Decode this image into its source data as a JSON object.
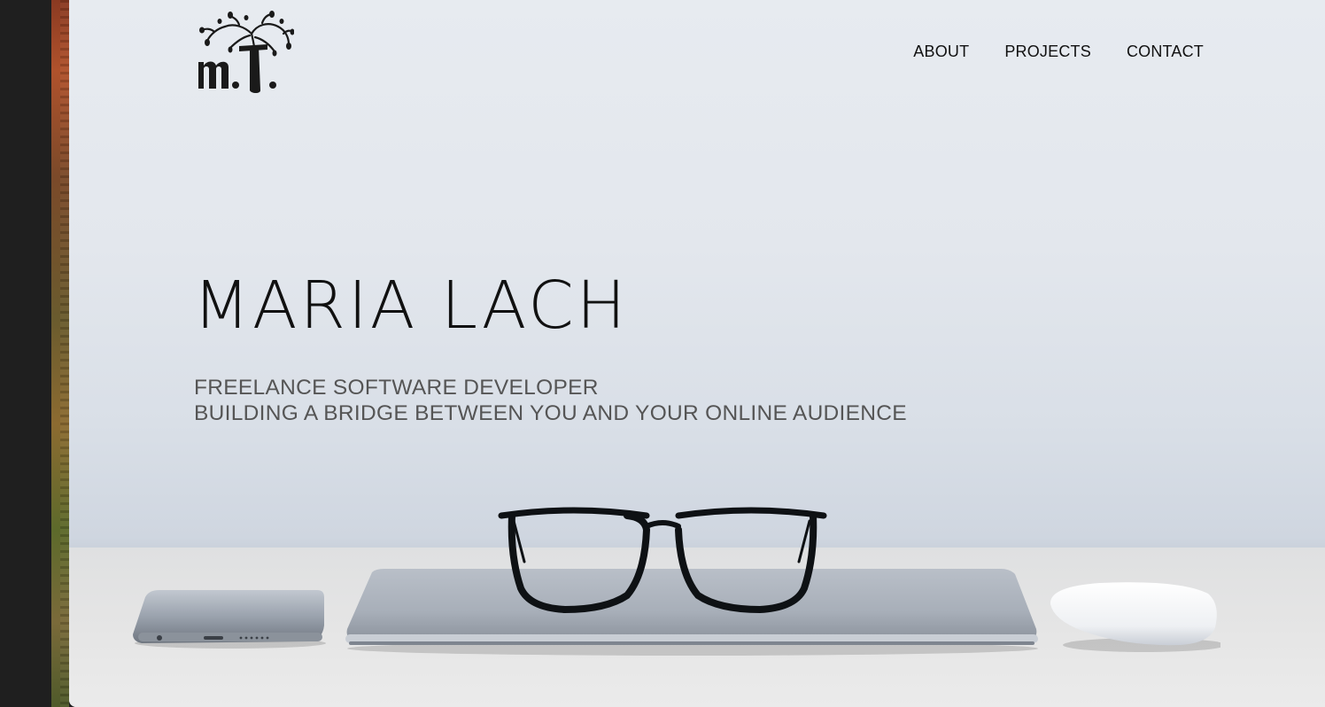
{
  "site": {
    "logo_alt": "m.T. logo"
  },
  "nav": {
    "items": [
      {
        "label": "ABOUT"
      },
      {
        "label": "PROJECTS"
      },
      {
        "label": "CONTACT"
      }
    ]
  },
  "hero": {
    "title": "MARIA LACH",
    "subtitle_line1": "FREELANCE SOFTWARE DEVELOPER",
    "subtitle_line2": "BUILDING A BRIDGE BETWEEN YOU AND YOUR ONLINE AUDIENCE"
  },
  "colors": {
    "text": "#111111",
    "subtitle": "#555555",
    "background_top": "#e7ebf0",
    "background_bottom": "#cfd6e0",
    "desk": "#e5e5e5"
  },
  "icons": {
    "logo": "tree-logo-icon",
    "phone": "smartphone-icon",
    "laptop": "laptop-icon",
    "glasses": "eyeglasses-icon",
    "mouse": "mouse-icon"
  }
}
